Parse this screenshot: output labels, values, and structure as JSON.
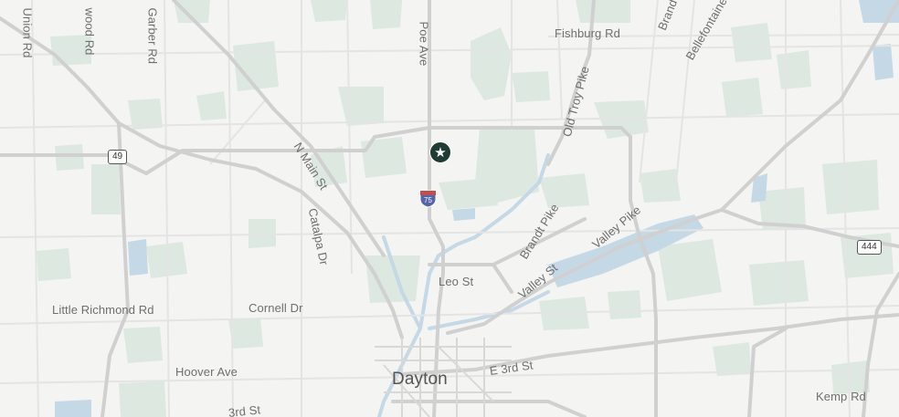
{
  "map": {
    "city": "Dayton",
    "streets": {
      "union_rd": "Union Rd",
      "wood_rd": "wood Rd",
      "garber_rd": "Garber Rd",
      "poe_ave": "Poe Ave",
      "fishburg_rd": "Fishburg Rd",
      "brand": "Brand",
      "bellefontaine": "Bellefontaine",
      "old_troy_pike": "Old Troy Pike",
      "n_main_st": "N Main St",
      "catalpa_dr": "Catalpa Dr",
      "brandt_pike": "Brandt Pike",
      "valley_pike": "Valley Pike",
      "valley_st": "Valley St",
      "leo_st": "Leo St",
      "little_richmond_rd": "Little Richmond Rd",
      "cornell_dr": "Cornell Dr",
      "hoover_ave": "Hoover Ave",
      "e_3rd_st": "E 3rd St",
      "kemp_rd": "Kemp Rd",
      "w_3rd_st": "3rd St"
    },
    "shields": {
      "sr49": "49",
      "i75": "75",
      "sr444": "444"
    },
    "marker": {
      "icon": "star-icon",
      "glyph": "★"
    },
    "colors": {
      "background": "#f4f4f3",
      "park": "#dde8e1",
      "water": "#c4d8e6",
      "major_road": "#d2d2d2",
      "minor_road": "#e6e6e6",
      "marker": "#1f3b33"
    }
  }
}
